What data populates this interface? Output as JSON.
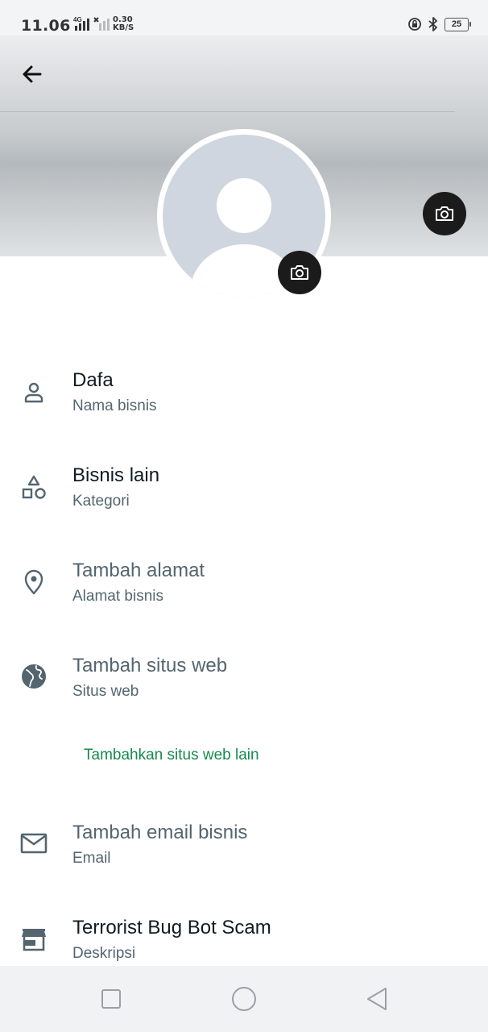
{
  "status_bar": {
    "time": "11.06",
    "network_type": "4G",
    "data_speed_value": "0.30",
    "data_speed_unit": "KB/S",
    "battery_level": "25",
    "icons": [
      "signal-icon",
      "no-signal-icon",
      "alarm-icon",
      "bluetooth-icon",
      "battery-icon"
    ]
  },
  "header": {
    "back_icon": "arrow-left-icon",
    "cover_camera_icon": "camera-icon",
    "avatar_camera_icon": "camera-icon"
  },
  "fields": [
    {
      "icon": "person-icon",
      "value": "Dafa",
      "label": "Nama bisnis",
      "is_placeholder": false
    },
    {
      "icon": "shapes-icon",
      "value": "Bisnis lain",
      "label": "Kategori",
      "is_placeholder": false
    },
    {
      "icon": "location-pin-icon",
      "value": "Tambah alamat",
      "label": "Alamat bisnis",
      "is_placeholder": true
    },
    {
      "icon": "globe-icon",
      "value": "Tambah situs web",
      "label": "Situs web",
      "is_placeholder": true
    },
    {
      "icon": "mail-icon",
      "value": "Tambah email bisnis",
      "label": "Email",
      "is_placeholder": true
    },
    {
      "icon": "storefront-icon",
      "value": "Terrorist Bug Bot Scam",
      "label": "Deskripsi",
      "is_placeholder": false
    }
  ],
  "add_website_link": "Tambahkan situs web lain",
  "colors": {
    "accent_green": "#168a4e",
    "primary_text": "#111b21",
    "secondary_text": "#54656f",
    "camera_button": "#1b1b1b",
    "avatar_placeholder": "#d0d6df"
  },
  "nav_bar": {
    "buttons": [
      "recents-square-icon",
      "home-circle-icon",
      "back-triangle-icon"
    ]
  }
}
